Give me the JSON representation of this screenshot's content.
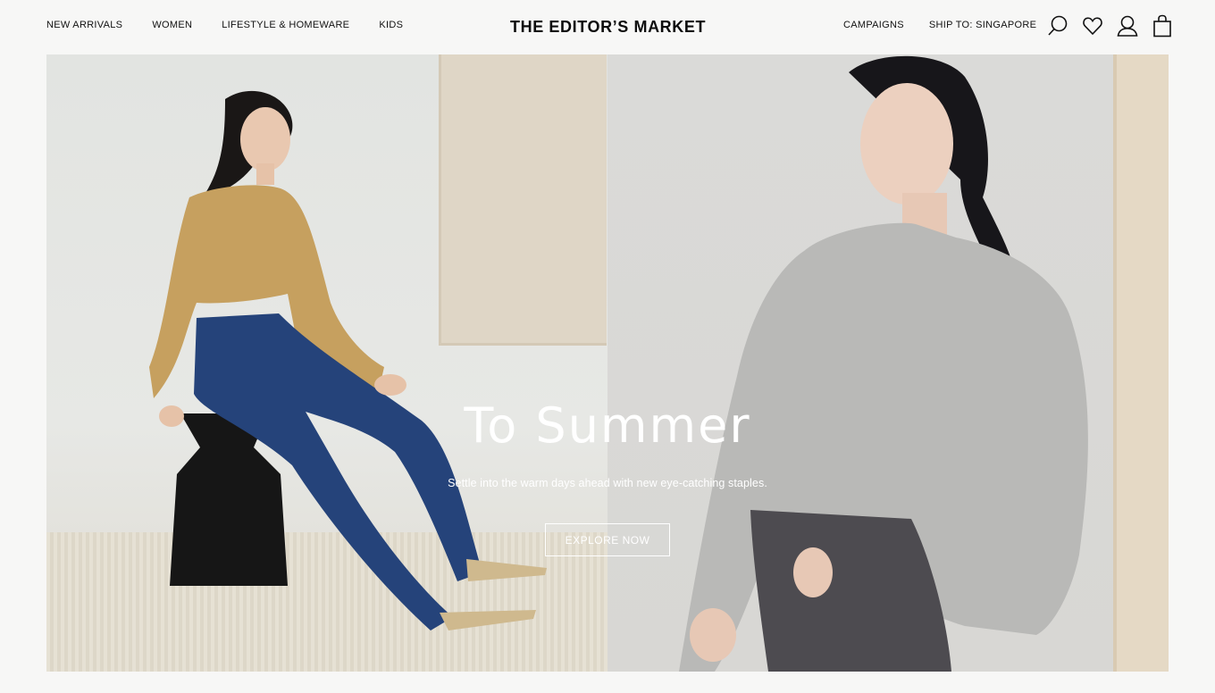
{
  "header": {
    "nav_left": [
      "NEW ARRIVALS",
      "WOMEN",
      "LIFESTYLE & HOMEWARE",
      "KIDS"
    ],
    "logo": "THE EDITOR’S MARKET",
    "nav_right": [
      "CAMPAIGNS",
      "SHIP TO: SINGAPORE"
    ],
    "icons": [
      "search-icon",
      "wishlist-heart-icon",
      "account-icon",
      "shopping-bag-icon"
    ]
  },
  "hero": {
    "title": "To Summer",
    "subtitle": "Settle into the warm days ahead with new eye-catching staples.",
    "cta_label": "EXPLORE NOW"
  },
  "colors": {
    "background": "#f7f7f6",
    "text": "#111111",
    "hero_text": "#ffffff"
  }
}
